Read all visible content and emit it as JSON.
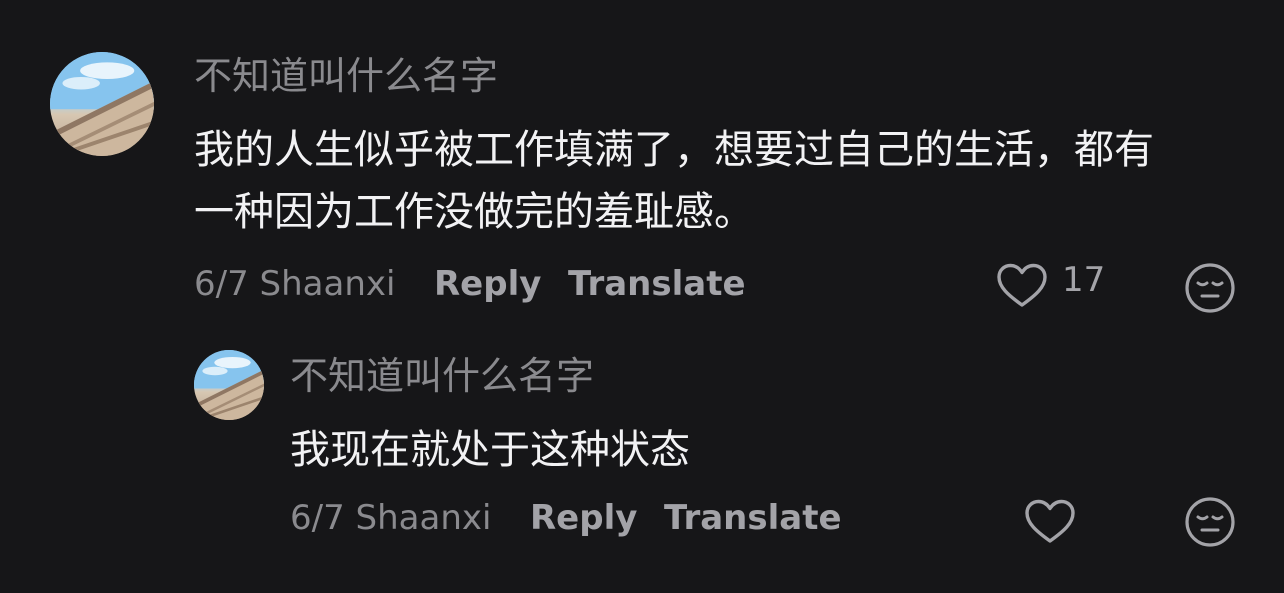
{
  "comments": [
    {
      "username": "不知道叫什么名字",
      "lines": [
        "我的人生似乎被工作填满了，想要过自己的生活，都有",
        "一种因为工作没做完的羞耻感。"
      ],
      "date_location": "6/7 Shaanxi",
      "reply_label": "Reply",
      "translate_label": "Translate",
      "like_count": "17"
    },
    {
      "username": "不知道叫什么名字",
      "lines": [
        "我现在就处于这种状态"
      ],
      "date_location": "6/7 Shaanxi",
      "reply_label": "Reply",
      "translate_label": "Translate",
      "like_count": ""
    }
  ],
  "icons": {
    "like": "heart-outline-icon",
    "dislike": "neutral-face-icon"
  },
  "colors": {
    "background": "#161618",
    "primary_text": "#f2f2f4",
    "secondary_text": "#8a8a8e",
    "action_text": "#a3a3a8"
  }
}
